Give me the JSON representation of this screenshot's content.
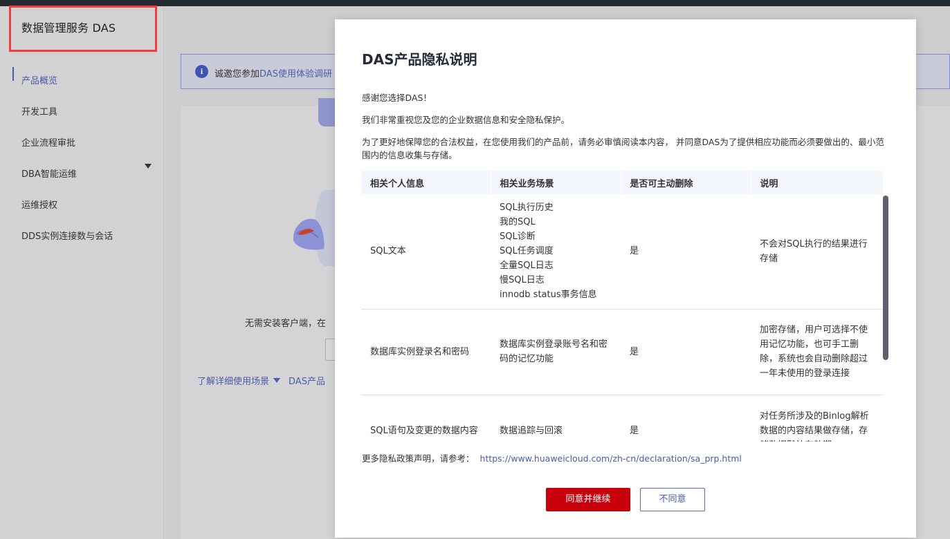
{
  "sidebar": {
    "title": "数据管理服务 DAS",
    "items": [
      {
        "label": "产品概览"
      },
      {
        "label": "开发工具"
      },
      {
        "label": "企业流程审批"
      },
      {
        "label": "DBA智能运维"
      },
      {
        "label": "运维授权"
      },
      {
        "label": "DDS实例连接数与会话"
      }
    ]
  },
  "background": {
    "notice_prefix": "诚邀您参加",
    "notice_link": "DAS使用体验调研",
    "intro_text": "无需安装客户端，在",
    "link_learn": "了解详细使用场景",
    "link_product": "DAS产品"
  },
  "dialog": {
    "title": "DAS产品隐私说明",
    "para1": "感谢您选择DAS！",
    "para2": "我们非常重视您及您的企业数据信息和安全隐私保护。",
    "para3": "为了更好地保障您的合法权益，在您使用我们的产品前，请务必审慎阅读本内容， 并同意DAS为了提供相应功能而必须要做出的、最小范围内的信息收集与存储。",
    "table": {
      "headers": [
        "相关个人信息",
        "相关业务场景",
        "是否可主动删除",
        "说明"
      ],
      "rows": [
        {
          "info": "SQL文本",
          "scenes": [
            "SQL执行历史",
            "我的SQL",
            "SQL诊断",
            "SQL任务调度",
            "全量SQL日志",
            "慢SQL日志",
            "innodb status事务信息"
          ],
          "deletable": "是",
          "desc": "不会对SQL执行的结果进行存储"
        },
        {
          "info": "数据库实例登录名和密码",
          "scenes": [
            "数据库实例登录账号名和密码的记忆功能"
          ],
          "deletable": "是",
          "desc": "加密存储，用户可选择不使用记忆功能，也可手工删除，系统也会自动删除超过一年未使用的登录连接"
        },
        {
          "info": "SQL语句及变更的数据内容",
          "scenes": [
            "数据追踪与回滚"
          ],
          "deletable": "是",
          "desc": "对任务所涉及的Binlog解析数据的内容结果做存储，存储数据默认有效期"
        }
      ]
    },
    "footer_note": "更多隐私政策声明，请参考：",
    "footer_link": "https://www.huaweicloud.com/zh-cn/declaration/sa_prp.html",
    "agree_label": "同意并继续",
    "disagree_label": "不同意"
  }
}
